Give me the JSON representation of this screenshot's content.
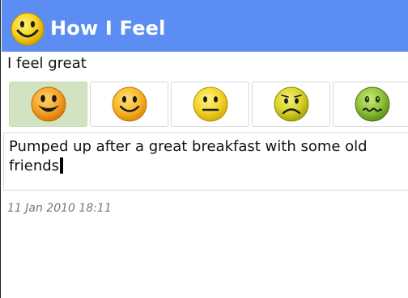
{
  "app": {
    "title": "How I Feel",
    "icon": "smiley-face-icon"
  },
  "status": {
    "text": "I feel great"
  },
  "moods": [
    {
      "name": "great",
      "icon": "grinning-face-icon",
      "selected": true
    },
    {
      "name": "good",
      "icon": "smiling-face-icon",
      "selected": false
    },
    {
      "name": "neutral",
      "icon": "neutral-face-icon",
      "selected": false
    },
    {
      "name": "sad",
      "icon": "frowning-face-icon",
      "selected": false
    },
    {
      "name": "sick",
      "icon": "sick-face-icon",
      "selected": false
    }
  ],
  "note": {
    "text": "Pumped up after a great breakfast with some old friends"
  },
  "entry": {
    "timestamp": "11 Jan 2010 18:11"
  },
  "colors": {
    "titlebar": "#5b8df2",
    "selected_mood": "#d2e3c1"
  }
}
